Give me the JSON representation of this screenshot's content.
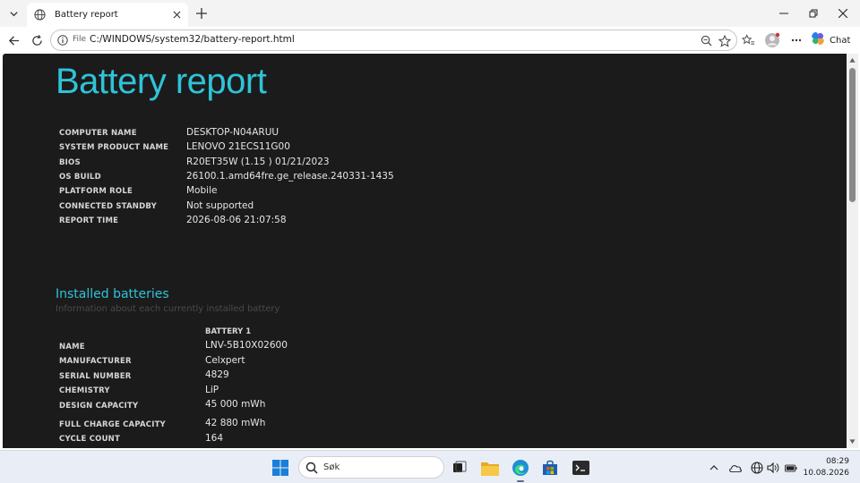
{
  "browser": {
    "tab_title": "Battery report",
    "address_prefix": "File",
    "url": "C:/WINDOWS/system32/battery-report.html",
    "chat_label": "Chat",
    "icons": [
      "tab-actions-icon",
      "globe-icon",
      "close-icon",
      "plus-icon",
      "minimize-icon",
      "restore-icon",
      "close-window-icon",
      "back-icon",
      "refresh-icon",
      "info-icon",
      "zoom-icon",
      "star-icon",
      "favorites-icon",
      "profile-icon",
      "more-icon",
      "copilot-icon"
    ]
  },
  "report": {
    "title": "Battery report",
    "system_info": [
      {
        "label": "COMPUTER NAME",
        "value": "DESKTOP-N04ARUU"
      },
      {
        "label": "SYSTEM PRODUCT NAME",
        "value": "LENOVO 21ECS11G00"
      },
      {
        "label": "BIOS",
        "value": "R20ET35W (1.15 ) 01/21/2023"
      },
      {
        "label": "OS BUILD",
        "value": "26100.1.amd64fre.ge_release.240331-1435"
      },
      {
        "label": "PLATFORM ROLE",
        "value": "Mobile"
      },
      {
        "label": "CONNECTED STANDBY",
        "value": "Not supported"
      },
      {
        "label": "REPORT TIME",
        "value": "2026-08-06  21:07:58"
      }
    ],
    "installed": {
      "title": "Installed batteries",
      "subtitle": "Information about each currently installed battery",
      "column_header": "BATTERY 1",
      "rows": [
        {
          "label": "NAME",
          "value": "LNV-5B10X02600"
        },
        {
          "label": "MANUFACTURER",
          "value": "Celxpert"
        },
        {
          "label": "SERIAL NUMBER",
          "value": "4829"
        },
        {
          "label": "CHEMISTRY",
          "value": "LiP"
        },
        {
          "label": "DESIGN CAPACITY",
          "value": "45 000 mWh"
        },
        {
          "label": "FULL CHARGE CAPACITY",
          "value": "42 880 mWh"
        },
        {
          "label": "CYCLE COUNT",
          "value": "164"
        }
      ]
    }
  },
  "taskbar": {
    "search_label": "Søk",
    "time": "08:29",
    "date": "10.08.2026",
    "apps": [
      "start-icon",
      "task-view-icon",
      "file-explorer-icon",
      "edge-icon",
      "store-icon",
      "terminal-icon"
    ],
    "tray": [
      "chevron-up-icon",
      "onedrive-icon",
      "network-icon",
      "volume-icon",
      "battery-icon"
    ]
  },
  "colors": {
    "accent": "#2fc3d8",
    "page_bg": "#1b1b1b",
    "text": "#e6e6e6"
  }
}
